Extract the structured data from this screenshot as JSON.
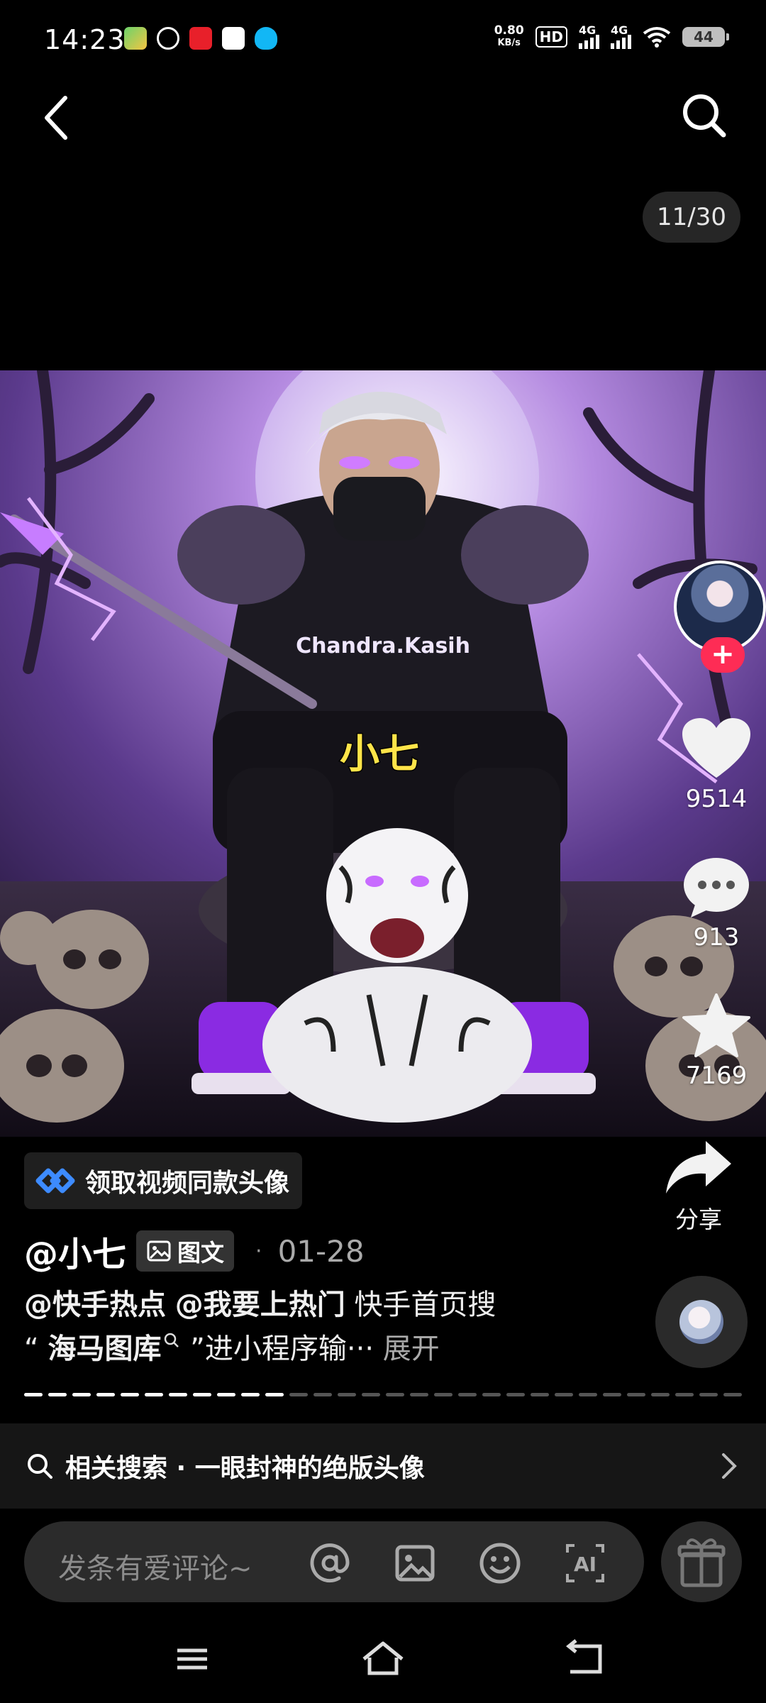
{
  "status_bar": {
    "time": "14:23",
    "net_speed_value": "0.80",
    "net_speed_unit": "KB/s",
    "hd_label": "HD",
    "sim1_label": "4G",
    "sim2_label": "4G",
    "battery": "44"
  },
  "header": {
    "page_counter": "11/30"
  },
  "image_overlay": {
    "shirt_text": "Chandra.Kasih",
    "name_text": "小七"
  },
  "actions": {
    "follow_symbol": "+",
    "like_count": "9514",
    "comment_count": "913",
    "favorite_count": "7169",
    "share_label": "分享"
  },
  "promo": {
    "label": "领取视频同款头像"
  },
  "post": {
    "author": "@小七",
    "type_badge": "图文",
    "separator": "·",
    "date": "01-28",
    "mention_1": "@快手热点",
    "mention_2": "@我要上热门",
    "caption_part_1": "快手首页搜",
    "caption_line2_quote_open": "“",
    "caption_keyword": "海马图库",
    "caption_line2_rest": "”进小程序输···",
    "expand_label": "展开",
    "slide_total": 30,
    "slide_current": 11
  },
  "related_search": {
    "label": "相关搜索 · 一眼封神的绝版头像"
  },
  "comment_bar": {
    "placeholder": "发条有爱评论~"
  },
  "colors": {
    "background": "#000000",
    "accent_red": "#fe2c55",
    "surface": "#2b2b2b",
    "link_blue": "#3d8bff"
  },
  "icons": [
    "back-arrow-icon",
    "search-icon",
    "heart-icon",
    "comment-icon",
    "star-icon",
    "share-arrow-icon",
    "mention-icon",
    "image-icon",
    "emoji-icon",
    "ai-icon",
    "gift-icon",
    "menu-icon",
    "home-icon",
    "return-icon"
  ]
}
